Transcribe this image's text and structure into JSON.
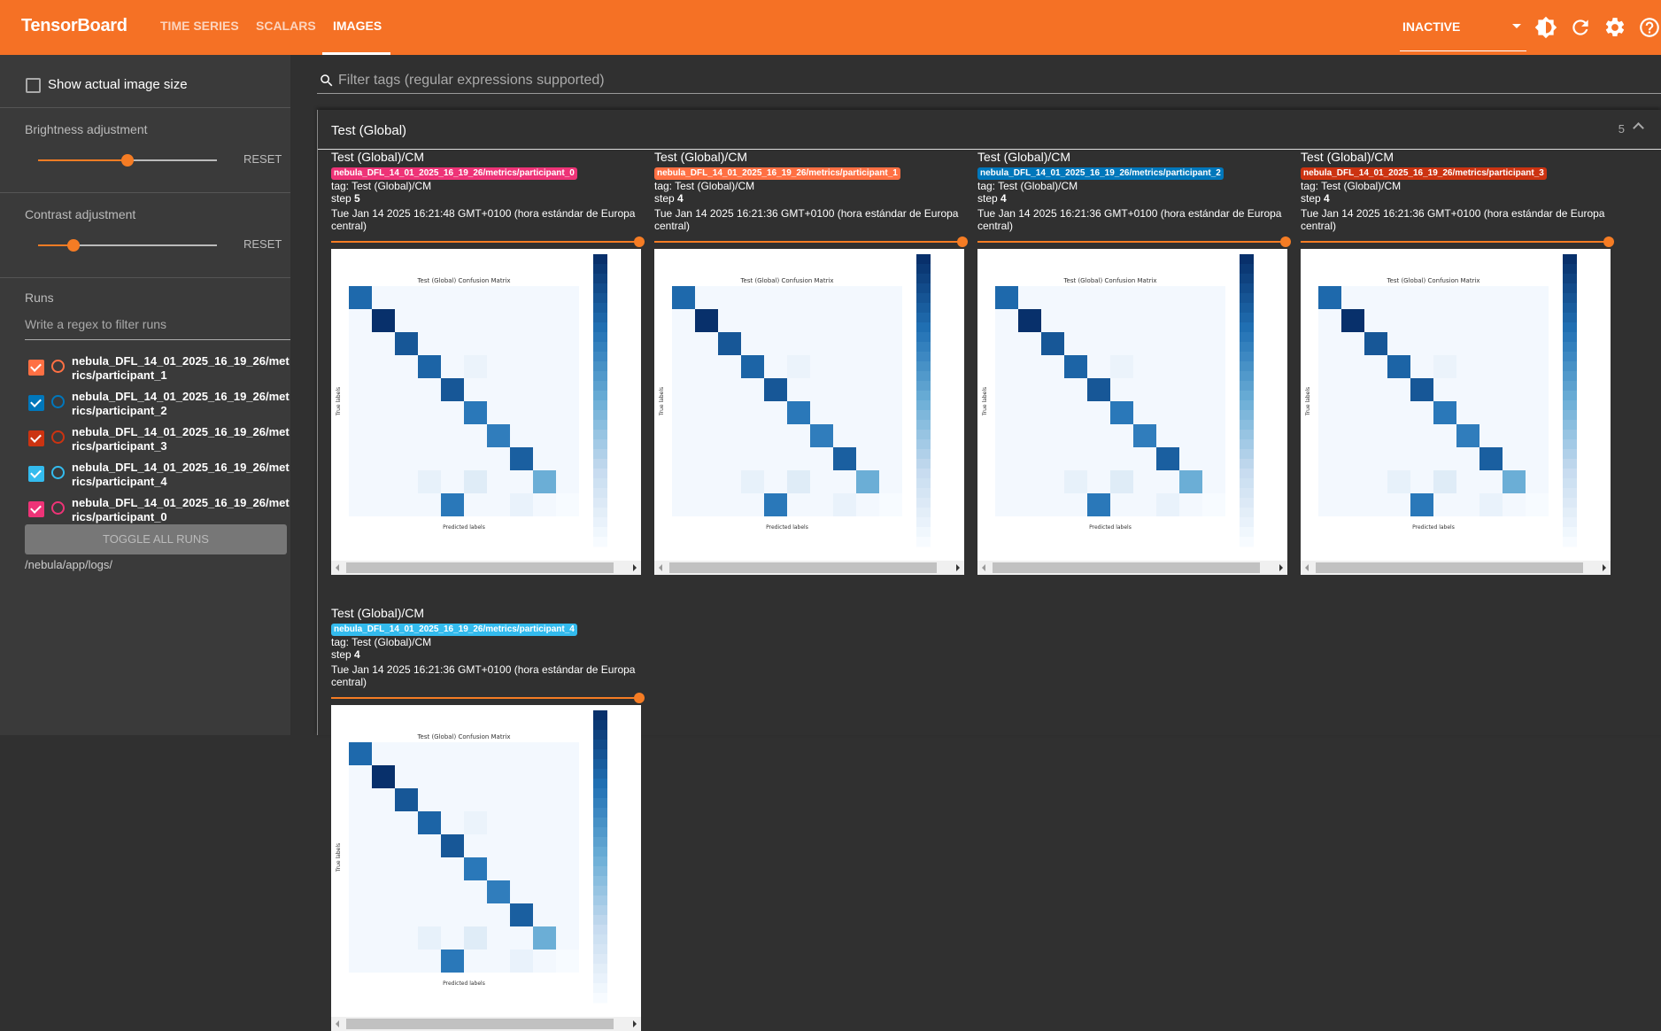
{
  "header": {
    "brand": "TensorBoard",
    "tabs": [
      {
        "label": "TIME SERIES",
        "active": false
      },
      {
        "label": "SCALARS",
        "active": false
      },
      {
        "label": "IMAGES",
        "active": true
      }
    ],
    "run_state_select": "INACTIVE",
    "icons": [
      "dark-mode-icon",
      "reload-icon",
      "settings-icon",
      "help-icon"
    ]
  },
  "sidebar": {
    "show_actual_size_label": "Show actual image size",
    "show_actual_size_checked": false,
    "brightness": {
      "title": "Brightness adjustment",
      "value_fraction": 0.5,
      "reset_label": "RESET"
    },
    "contrast": {
      "title": "Contrast adjustment",
      "value_fraction": 0.2,
      "reset_label": "RESET"
    },
    "runs": {
      "title": "Runs",
      "filter_placeholder": "Write a regex to filter runs",
      "items": [
        {
          "name": "nebula_DFL_14_01_2025_16_19_26/metrics/participant_1",
          "color": "#ff7043",
          "checked": true
        },
        {
          "name": "nebula_DFL_14_01_2025_16_19_26/metrics/participant_2",
          "color": "#0077bb",
          "checked": true
        },
        {
          "name": "nebula_DFL_14_01_2025_16_19_26/metrics/participant_3",
          "color": "#cc3311",
          "checked": true
        },
        {
          "name": "nebula_DFL_14_01_2025_16_19_26/metrics/participant_4",
          "color": "#33bbee",
          "checked": true
        },
        {
          "name": "nebula_DFL_14_01_2025_16_19_26/metrics/participant_0",
          "color": "#ee3377",
          "checked": true
        }
      ],
      "toggle_all_label": "TOGGLE ALL RUNS",
      "log_dir": "/nebula/app/logs/"
    }
  },
  "main": {
    "filter_tags_placeholder": "Filter tags (regular expressions supported)",
    "group": {
      "title": "Test (Global)",
      "count": "5",
      "cards": [
        {
          "title": "Test (Global)/CM",
          "run": "nebula_DFL_14_01_2025_16_19_26/metrics/participant_0",
          "run_color": "#ee3377",
          "tag": "tag: Test (Global)/CM",
          "step_label": "step",
          "step": "5",
          "timestamp": "Tue Jan 14 2025 16:21:48 GMT+0100 (hora estándar de Europa central)"
        },
        {
          "title": "Test (Global)/CM",
          "run": "nebula_DFL_14_01_2025_16_19_26/metrics/participant_1",
          "run_color": "#ff7043",
          "tag": "tag: Test (Global)/CM",
          "step_label": "step",
          "step": "4",
          "timestamp": "Tue Jan 14 2025 16:21:36 GMT+0100 (hora estándar de Europa central)"
        },
        {
          "title": "Test (Global)/CM",
          "run": "nebula_DFL_14_01_2025_16_19_26/metrics/participant_2",
          "run_color": "#0077bb",
          "tag": "tag: Test (Global)/CM",
          "step_label": "step",
          "step": "4",
          "timestamp": "Tue Jan 14 2025 16:21:36 GMT+0100 (hora estándar de Europa central)"
        },
        {
          "title": "Test (Global)/CM",
          "run": "nebula_DFL_14_01_2025_16_19_26/metrics/participant_3",
          "run_color": "#cc3311",
          "tag": "tag: Test (Global)/CM",
          "step_label": "step",
          "step": "4",
          "timestamp": "Tue Jan 14 2025 16:21:36 GMT+0100 (hora estándar de Europa central)"
        },
        {
          "title": "Test (Global)/CM",
          "run": "nebula_DFL_14_01_2025_16_19_26/metrics/participant_4",
          "run_color": "#33bbee",
          "tag": "tag: Test (Global)/CM",
          "step_label": "step",
          "step": "4",
          "timestamp": "Tue Jan 14 2025 16:21:36 GMT+0100 (hora estándar de Europa central)"
        }
      ]
    }
  },
  "confusion_matrix_image": {
    "title": "Test (Global) Confusion Matrix",
    "xlabel": "Predicted labels",
    "ylabel": "True labels",
    "diagonal_intensity": [
      0.78,
      1.0,
      0.85,
      0.8,
      0.85,
      0.72,
      0.7,
      0.82,
      0.5,
      0.0
    ],
    "offdiag": [
      [
        9,
        4,
        0.72
      ],
      [
        8,
        5,
        0.12
      ],
      [
        8,
        3,
        0.08
      ],
      [
        3,
        5,
        0.06
      ],
      [
        9,
        7,
        0.07
      ]
    ]
  }
}
